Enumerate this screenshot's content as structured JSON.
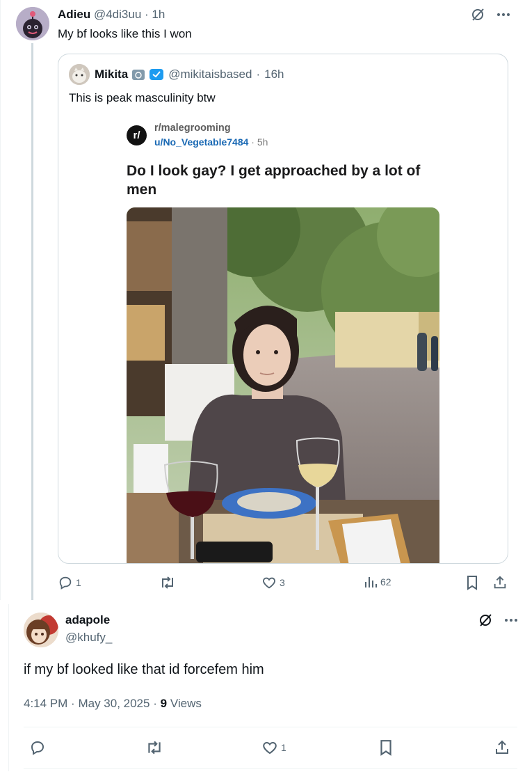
{
  "tweet1": {
    "display_name": "Adieu",
    "handle": "@4di3uu",
    "separator": "·",
    "time": "1h",
    "text": "My bf looks like this I won",
    "quote": {
      "display_name": "Mikita",
      "handle": "@mikitaisbased",
      "time": "16h",
      "text": "This is peak masculinity btw",
      "reddit": {
        "logo": "r/",
        "subreddit": "r/malegrooming",
        "user": "u/No_Vegetable7484",
        "time": "· 5h",
        "title": "Do I look gay? I get approached by a lot of men"
      }
    },
    "actions": {
      "replies": "1",
      "reposts": "",
      "likes": "3",
      "views": "62"
    }
  },
  "tweet2": {
    "display_name": "adapole",
    "handle": "@khufy_",
    "text": "if my bf looked like that id forcefem him",
    "time": "4:14 PM",
    "date": "May 30, 2025",
    "views_count": "9",
    "views_label": "Views",
    "separator": "·",
    "actions": {
      "replies": "",
      "reposts": "",
      "likes": "1"
    }
  },
  "icons": {
    "grok": "grok-icon",
    "more": "more-icon",
    "reply": "reply-icon",
    "repost": "repost-icon",
    "like": "heart-icon",
    "views": "views-icon",
    "bookmark": "bookmark-icon",
    "share": "share-icon"
  },
  "colors": {
    "text_primary": "#0f1419",
    "text_secondary": "#536471",
    "border": "#cfd9de",
    "reddit_link": "#1a69b4",
    "verified_blue": "#1d9bf0",
    "gov_badge": "#829aab"
  }
}
